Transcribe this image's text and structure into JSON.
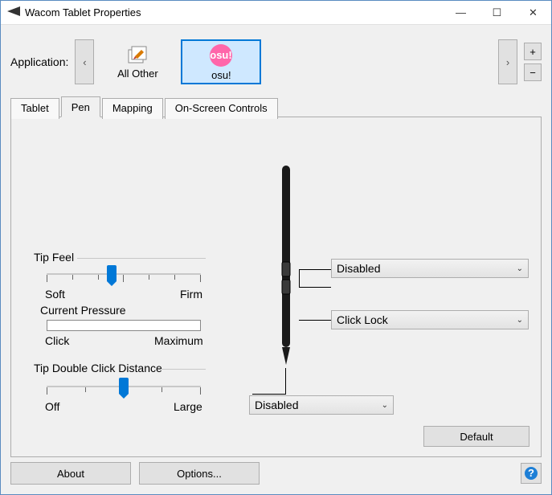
{
  "window": {
    "title": "Wacom Tablet Properties"
  },
  "application": {
    "label": "Application:",
    "items": [
      {
        "label": "All Other"
      },
      {
        "label": "osu!"
      }
    ],
    "selected_index": 1
  },
  "tabs": {
    "items": [
      "Tablet",
      "Pen",
      "Mapping",
      "On-Screen Controls"
    ],
    "active_index": 1
  },
  "pen_tab": {
    "tip_feel": {
      "label": "Tip Feel",
      "soft": "Soft",
      "firm": "Firm",
      "value_pct": 42
    },
    "current_pressure": {
      "label": "Current Pressure",
      "click": "Click",
      "maximum": "Maximum"
    },
    "double_click": {
      "label": "Tip Double Click Distance",
      "off": "Off",
      "large": "Large",
      "value_pct": 50
    },
    "side_button_upper": "Disabled",
    "side_button_lower": "Click Lock",
    "tip_action": "Disabled",
    "default_button": "Default"
  },
  "footer": {
    "about": "About",
    "options": "Options..."
  },
  "icons": {
    "plus": "+",
    "minus": "−",
    "left": "‹",
    "right": "›",
    "chevron": "⌄",
    "minimize": "—",
    "maximize": "☐",
    "close": "✕"
  }
}
